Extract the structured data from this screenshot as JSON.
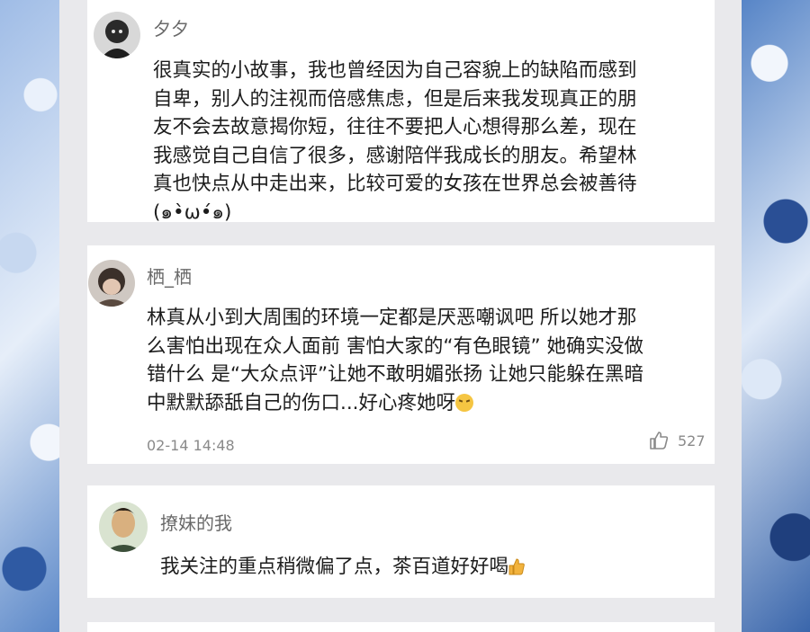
{
  "comments": [
    {
      "username": "夕夕",
      "lines": [
        "很真实的小故事，我也曾经因为自己容貌上的缺陷而感到",
        "自卑，别人的注视而倍感焦虑，但是后来我发现真正的朋",
        "友不会去故意揭你短，往往不要把人心想得那么差，现在",
        "我感觉自己自信了很多，感谢陪伴我成长的朋友。希望林",
        "真也快点从中走出来，比较可爱的女孩在世界总会被善待",
        "(๑•̀ω•́๑)"
      ]
    },
    {
      "username": "栖_栖",
      "lines": [
        "林真从小到大周围的环境一定都是厌恶嘲讽吧 所以她才那",
        "么害怕出现在众人面前 害怕大家的“有色眼镜” 她确实没做",
        "错什么 是“大众点评”让她不敢明媚张扬 让她只能躲在黑暗",
        "中默默舔舐自己的伤口...好心疼她呀"
      ],
      "emoji_icon": "sad-face-emoji-icon",
      "timestamp": "02-14 14:48",
      "likes": "527"
    },
    {
      "username": "撩妹的我",
      "lines": [
        "我关注的重点稍微偏了点，茶百道好好喝"
      ],
      "emoji_icon": "thumbs-up-emoji-icon"
    }
  ],
  "colors": {
    "background": "#3f6fb6",
    "panel": "#e9e9ec",
    "card": "#ffffff",
    "text": "#1c1c1c",
    "meta": "#8a8a8a"
  }
}
